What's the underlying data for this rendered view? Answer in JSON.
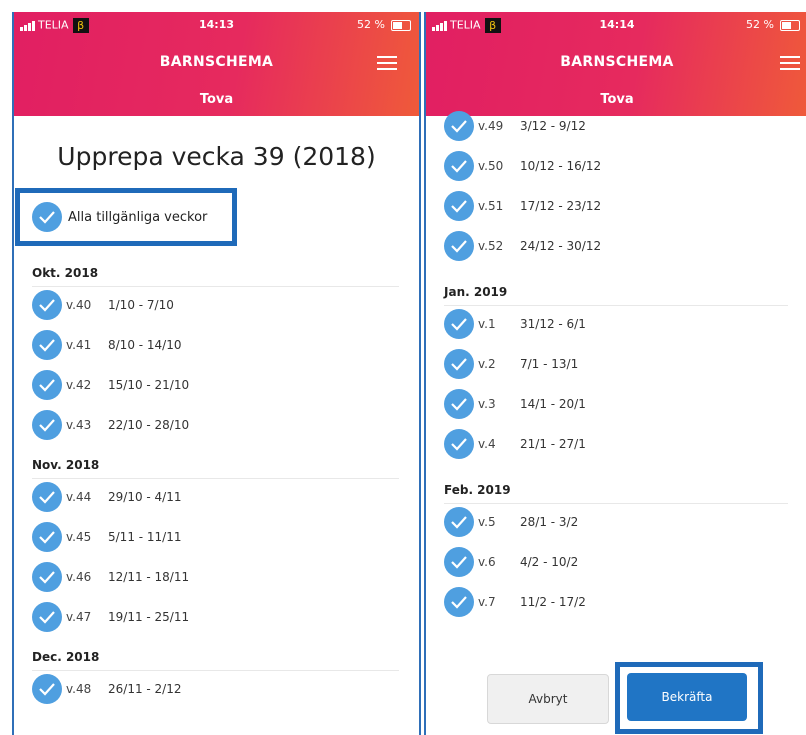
{
  "left": {
    "status": {
      "carrier": "TELIA",
      "beta": "β",
      "time": "14:13",
      "battery": "52 %"
    },
    "header": {
      "title": "BARNSCHEMA",
      "subtitle": "Tova"
    },
    "page_title": "Upprepa vecka 39 (2018)",
    "all_label": "Alla tillgänliga veckor",
    "months": [
      {
        "name": "Okt. 2018",
        "weeks": [
          {
            "week": "v.40",
            "range": "1/10 - 7/10"
          },
          {
            "week": "v.41",
            "range": "8/10 - 14/10"
          },
          {
            "week": "v.42",
            "range": "15/10 - 21/10"
          },
          {
            "week": "v.43",
            "range": "22/10 - 28/10"
          }
        ]
      },
      {
        "name": "Nov. 2018",
        "weeks": [
          {
            "week": "v.44",
            "range": "29/10 - 4/11"
          },
          {
            "week": "v.45",
            "range": "5/11 - 11/11"
          },
          {
            "week": "v.46",
            "range": "12/11 - 18/11"
          },
          {
            "week": "v.47",
            "range": "19/11 - 25/11"
          }
        ]
      },
      {
        "name": "Dec. 2018",
        "weeks": [
          {
            "week": "v.48",
            "range": "26/11 - 2/12"
          }
        ]
      }
    ]
  },
  "right": {
    "status": {
      "carrier": "TELIA",
      "beta": "β",
      "time": "14:14",
      "battery": "52 %"
    },
    "header": {
      "title": "BARNSCHEMA",
      "subtitle": "Tova"
    },
    "top_weeks": [
      {
        "week": "v.49",
        "range": "3/12 - 9/12"
      },
      {
        "week": "v.50",
        "range": "10/12 - 16/12"
      },
      {
        "week": "v.51",
        "range": "17/12 - 23/12"
      },
      {
        "week": "v.52",
        "range": "24/12 - 30/12"
      }
    ],
    "months": [
      {
        "name": "Jan. 2019",
        "weeks": [
          {
            "week": "v.1",
            "range": "31/12 - 6/1"
          },
          {
            "week": "v.2",
            "range": "7/1 - 13/1"
          },
          {
            "week": "v.3",
            "range": "14/1 - 20/1"
          },
          {
            "week": "v.4",
            "range": "21/1 - 27/1"
          }
        ]
      },
      {
        "name": "Feb. 2019",
        "weeks": [
          {
            "week": "v.5",
            "range": "28/1 - 3/2"
          },
          {
            "week": "v.6",
            "range": "4/2 - 10/2"
          },
          {
            "week": "v.7",
            "range": "11/2 - 17/2"
          }
        ]
      }
    ],
    "cancel_label": "Avbryt",
    "confirm_label": "Bekräfta"
  },
  "colors": {
    "header_start": "#e11f62",
    "header_end": "#ef5a3a",
    "check": "#4f9fe0",
    "highlight_border": "#1f6ab9",
    "confirm": "#2075c5"
  },
  "icons": {
    "check": "checkmark-icon",
    "menu": "hamburger-menu-icon"
  }
}
